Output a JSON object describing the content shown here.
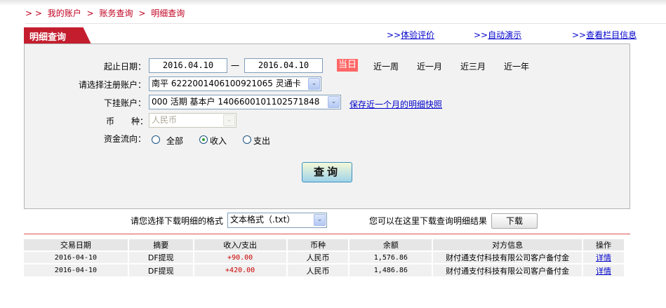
{
  "breadcrumb": [
    "> >",
    "我的账户",
    ">",
    "账务查询",
    ">",
    "明细查询"
  ],
  "tab_title": "明细查询",
  "top_links": [
    {
      "prefix": ">>",
      "label": "体验评价"
    },
    {
      "prefix": ">>",
      "label": "自动演示"
    },
    {
      "prefix": ">>",
      "label": "查看栏目信息"
    }
  ],
  "form": {
    "date_label": "起止日期：",
    "start_date": "2016.04.10",
    "dash": "一",
    "end_date": "2016.04.10",
    "quick_ranges": [
      "当日",
      "近一周",
      "近一月",
      "近三月",
      "近一年"
    ],
    "active_range": "当日",
    "reg_account_label": "请选择注册账户：",
    "reg_account_value": "南平 6222001406100921065 灵通卡",
    "sub_account_label": "下挂账户：",
    "sub_account_value": "000 活期 基本户 1406600101102571848",
    "snapshot_link": "保存近一个月的明细快照",
    "currency_label": "币　　种：",
    "currency_value": "人民币",
    "flow_label": "资金流向：",
    "flow_options": [
      "全部",
      "收入",
      "支出"
    ],
    "flow_selected": "收入",
    "query_button": "查询"
  },
  "download": {
    "format_label": "请您选择下载明细的格式",
    "format_value": "文本格式（.txt）",
    "hint": "您可以在这里下载查询明细结果",
    "button": "下载"
  },
  "table": {
    "headers": [
      "交易日期",
      "摘要",
      "收入/支出",
      "币种",
      "余额",
      "对方信息",
      "操作"
    ],
    "rows": [
      [
        "2016-04-10",
        "DF提现",
        "+90.00",
        "人民币",
        "1,576.86",
        "财付通支付科技有限公司客户备付金",
        "详情"
      ],
      [
        "2016-04-10",
        "DF提现",
        "+420.00",
        "人民币",
        "1,486.86",
        "财付通支付科技有限公司客户备付金",
        "详情"
      ]
    ]
  },
  "colors": {
    "brand_red": "#c41e2e",
    "active_range_bg": "#ff6666",
    "amount_red": "#cc0000",
    "link_blue": "#0000cc"
  }
}
